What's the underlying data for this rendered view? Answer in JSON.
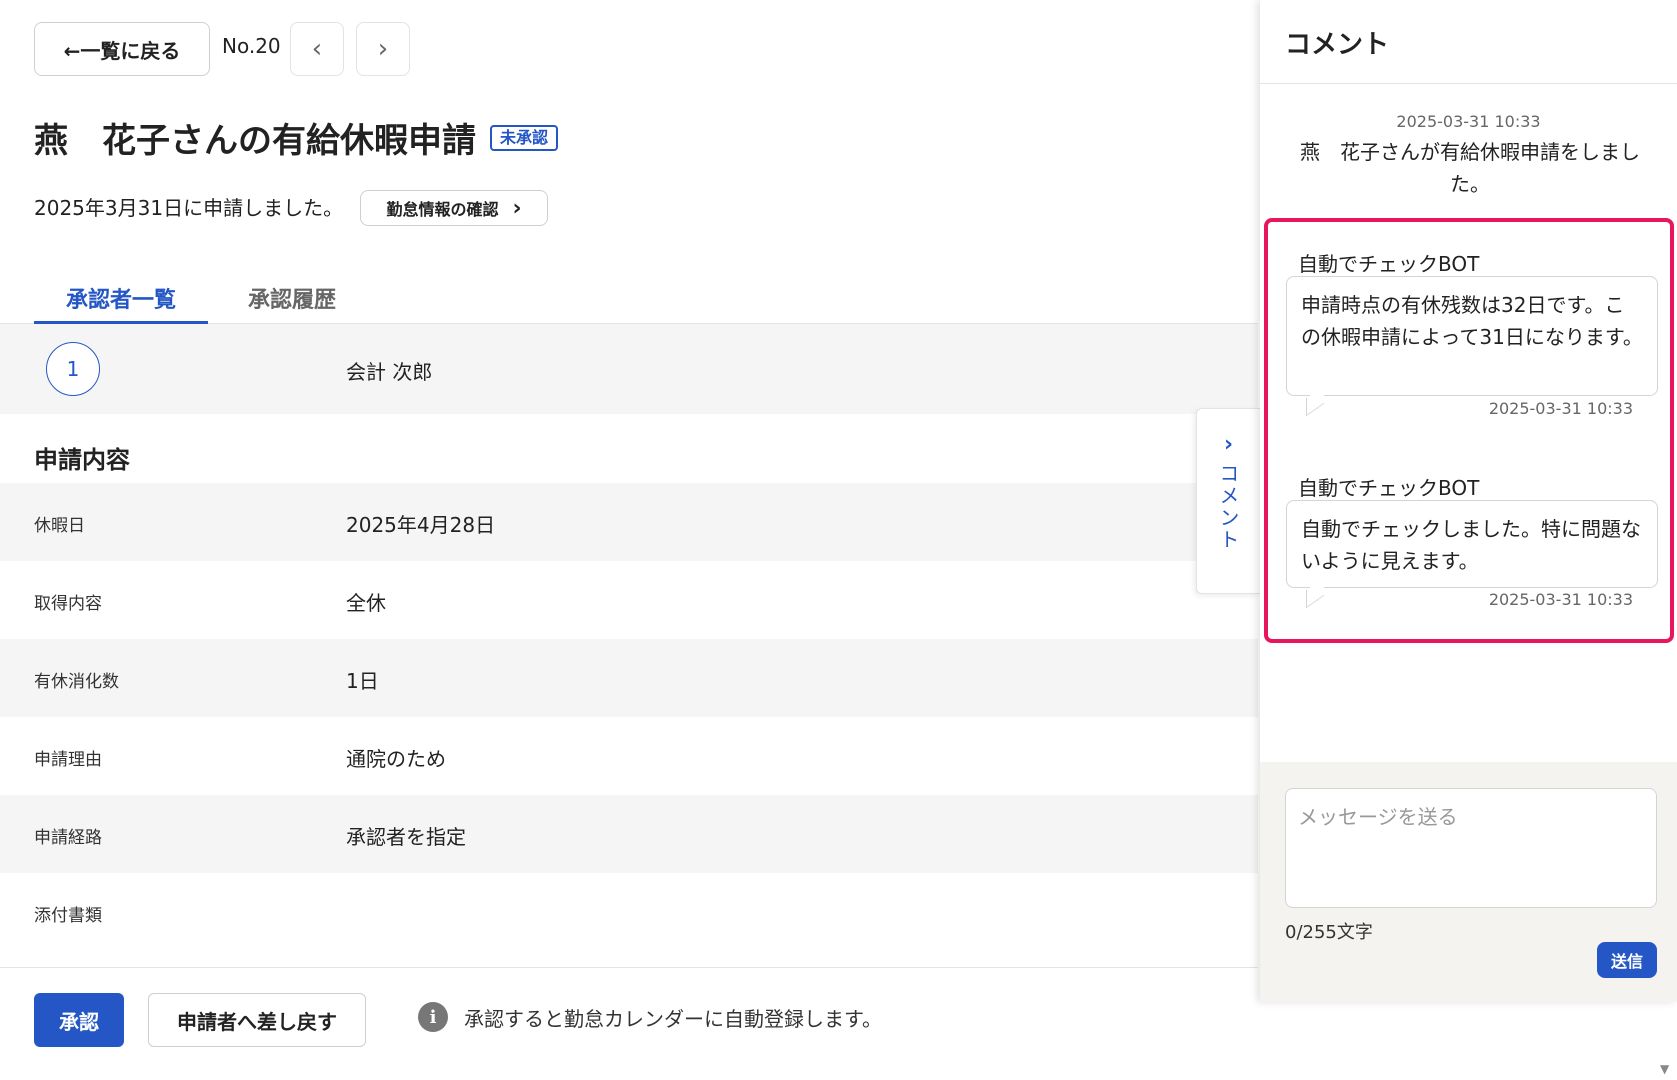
{
  "header": {
    "back_label": "←一覧に戻る",
    "record_no": "No.20",
    "prev_glyph": "‹",
    "next_glyph": "›"
  },
  "request": {
    "title": "燕　花子さんの有給休暇申請",
    "status_badge": "未承認",
    "applied_text": "2025年3月31日に申請しました。",
    "attendance_button": "勤怠情報の確認",
    "attendance_chevron": "›"
  },
  "tabs": [
    {
      "label": "承認者一覧"
    },
    {
      "label": "承認履歴"
    }
  ],
  "approvers": [
    {
      "step": "1",
      "name": "会計 次郎"
    }
  ],
  "details": {
    "section_title": "申請内容",
    "rows": [
      {
        "label": "休暇日",
        "value": "2025年4月28日"
      },
      {
        "label": "取得内容",
        "value": "全休"
      },
      {
        "label": "有休消化数",
        "value": "1日"
      },
      {
        "label": "申請理由",
        "value": "通院のため"
      },
      {
        "label": "申請経路",
        "value": "承認者を指定"
      },
      {
        "label": "添付書類",
        "value": ""
      }
    ]
  },
  "footer": {
    "approve_label": "承認",
    "return_label": "申請者へ差し戻す",
    "info_glyph": "i",
    "info_text": "承認すると勤怠カレンダーに自動登録します。"
  },
  "comment_toggle": {
    "chevron": "›",
    "label": "コメント"
  },
  "comments": {
    "title": "コメント",
    "system": {
      "time": "2025-03-31 10:33",
      "text": "燕　花子さんが有給休暇申請をしました。"
    },
    "messages": [
      {
        "author": "自動でチェックBOT",
        "text": "申請時点の有休残数は32日です。この休暇申請によって31日になります。",
        "time": "2025-03-31 10:33"
      },
      {
        "author": "自動でチェックBOT",
        "text": "自動でチェックしました。特に問題ないように見えます。",
        "time": "2025-03-31 10:33"
      }
    ],
    "composer": {
      "placeholder": "メッセージを送る",
      "value": "",
      "char_count": "0/255文字",
      "send_label": "送信"
    }
  },
  "colors": {
    "accent": "#2457c5",
    "highlight": "#e8175d",
    "row_shade": "#f5f5f5"
  }
}
